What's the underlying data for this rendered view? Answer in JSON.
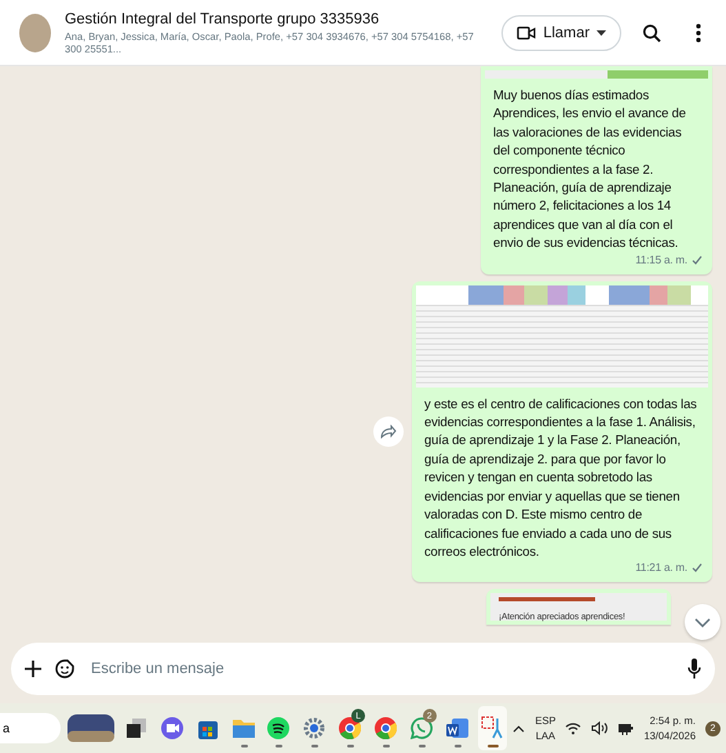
{
  "header": {
    "title": "Gestión Integral del Transporte grupo 3335936",
    "participants": "Ana, Bryan, Jessica, María, Oscar, Paola, Profe, +57 304 3934676, +57 304 5754168, +57 300 25551...",
    "call_button": "Llamar"
  },
  "messages": [
    {
      "kind": "text",
      "has_image_above": true,
      "text": "Muy buenos días estimados Aprendices, les envio el avance de las valoraciones de las evidencias del componente técnico correspondientes a la fase 2. Planeación, guía de aprendizaje número 2, felicitaciones a los 14 aprendices que van al día con el envio de sus evidencias técnicas.",
      "time": "11:15 a. m.",
      "sent": true
    },
    {
      "kind": "image_text",
      "forward": true,
      "text": "y este es el centro de calificaciones con todas las evidencias correspondientes a la fase 1. Análisis, guía de aprendizaje 1 y la Fase 2. Planeación, guía de aprendizaje 2. para que por favor lo revicen y tengan en cuenta sobretodo las evidencias por enviar y aquellas que se tienen valoradas con D. Este mismo centro de calificaciones fue enviado a cada uno de sus correos electrónicos.",
      "time": "11:21 a. m.",
      "sent": true
    },
    {
      "kind": "document",
      "text": "¡Atención apreciados aprendices!"
    }
  ],
  "composer": {
    "placeholder": "Escribe un mensaje"
  },
  "taskbar": {
    "search": {
      "value": "a"
    },
    "apps": [
      {
        "kind": "widget",
        "running": false,
        "selected": false
      },
      {
        "kind": "taskview",
        "running": false,
        "selected": false
      },
      {
        "kind": "meet",
        "running": false,
        "selected": false
      },
      {
        "kind": "store",
        "running": false,
        "selected": false
      },
      {
        "kind": "folder",
        "running": true,
        "selected": false
      },
      {
        "kind": "spotify",
        "running": true,
        "selected": false
      },
      {
        "kind": "settings",
        "running": true,
        "selected": false
      },
      {
        "kind": "chrome",
        "badge": "L",
        "running": true,
        "selected": false
      },
      {
        "kind": "chrome",
        "running": true,
        "selected": false
      },
      {
        "kind": "whatsapp",
        "badge": "2",
        "running": true,
        "selected": false
      },
      {
        "kind": "word",
        "running": true,
        "selected": false
      },
      {
        "kind": "snip",
        "running": true,
        "selected": true
      }
    ],
    "language": "ESP",
    "layout": "LAA",
    "time": "2:54 p. m.",
    "date": "13/04/2026",
    "notifications": "2"
  }
}
